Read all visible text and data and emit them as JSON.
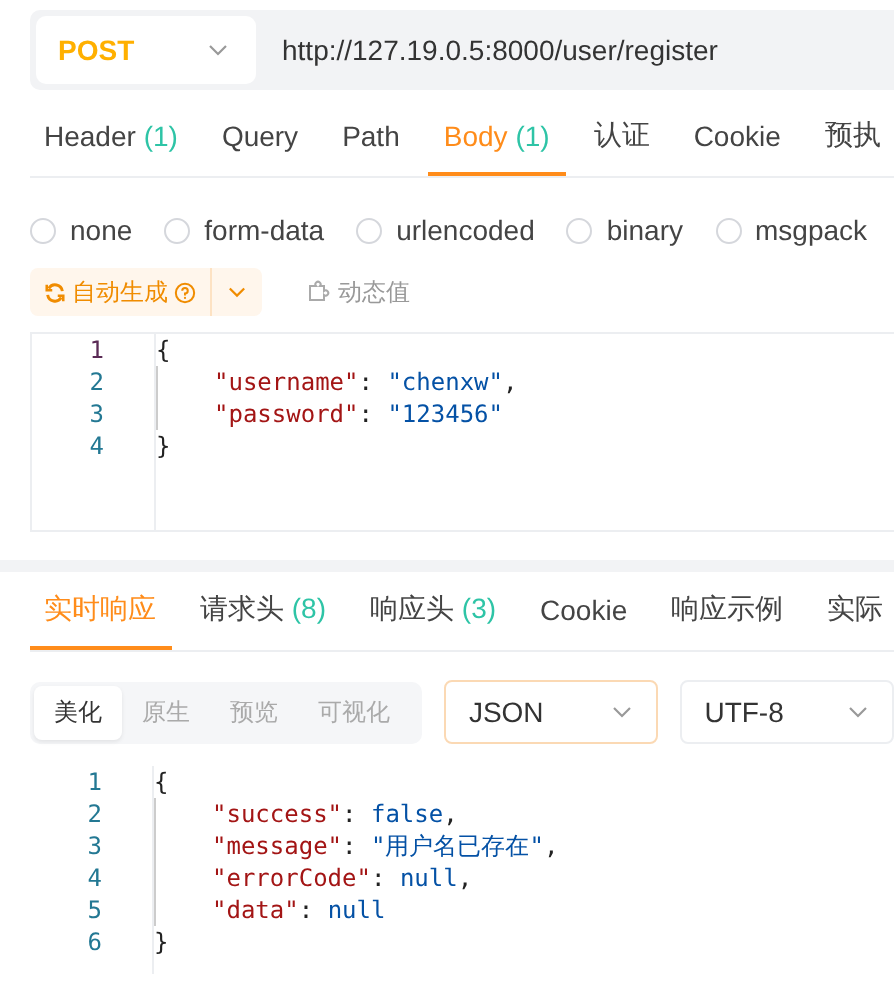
{
  "request": {
    "method": "POST",
    "url": "http://127.19.0.5:8000/user/register"
  },
  "request_tabs": [
    {
      "label": "Header",
      "count": "(1)",
      "selected": false
    },
    {
      "label": "Query",
      "selected": false
    },
    {
      "label": "Path",
      "selected": false
    },
    {
      "label": "Body",
      "count": "(1)",
      "selected": true
    },
    {
      "label": "认证",
      "selected": false
    },
    {
      "label": "Cookie",
      "selected": false
    },
    {
      "label": "预执",
      "selected": false
    }
  ],
  "body_types": [
    {
      "label": "none",
      "selected": false
    },
    {
      "label": "form-data",
      "selected": false
    },
    {
      "label": "urlencoded",
      "selected": false
    },
    {
      "label": "binary",
      "selected": false
    },
    {
      "label": "msgpack",
      "selected": false
    }
  ],
  "body_toolbar": {
    "auto_generate": "自动生成",
    "dynamic_value": "动态值"
  },
  "request_body": {
    "lines": [
      {
        "number": "1",
        "indented": false,
        "active": true,
        "tokens": [
          {
            "kind": "punct",
            "text": "{"
          }
        ]
      },
      {
        "number": "2",
        "indented": true,
        "active": false,
        "tokens": [
          {
            "kind": "key",
            "text": "\"username\""
          },
          {
            "kind": "punct",
            "text": ": "
          },
          {
            "kind": "string",
            "text": "\"chenxw\""
          },
          {
            "kind": "punct",
            "text": ","
          }
        ]
      },
      {
        "number": "3",
        "indented": true,
        "active": false,
        "tokens": [
          {
            "kind": "key",
            "text": "\"password\""
          },
          {
            "kind": "punct",
            "text": ": "
          },
          {
            "kind": "string",
            "text": "\"123456\""
          }
        ]
      },
      {
        "number": "4",
        "indented": false,
        "active": false,
        "tokens": [
          {
            "kind": "punct",
            "text": "}"
          }
        ]
      }
    ]
  },
  "response_tabs": [
    {
      "label": "实时响应",
      "selected": true
    },
    {
      "label": "请求头",
      "count": "(8)",
      "selected": false
    },
    {
      "label": "响应头",
      "count": "(3)",
      "selected": false
    },
    {
      "label": "Cookie",
      "selected": false
    },
    {
      "label": "响应示例",
      "selected": false
    },
    {
      "label": "实际",
      "selected": false
    }
  ],
  "view_modes": [
    {
      "label": "美化",
      "selected": true
    },
    {
      "label": "原生",
      "selected": false
    },
    {
      "label": "预览",
      "selected": false
    },
    {
      "label": "可视化",
      "selected": false
    }
  ],
  "format_select": {
    "value": "JSON"
  },
  "encoding_select": {
    "value": "UTF-8"
  },
  "response_body": {
    "lines": [
      {
        "number": "1",
        "indented": false,
        "active": false,
        "tokens": [
          {
            "kind": "punct",
            "text": "{"
          }
        ]
      },
      {
        "number": "2",
        "indented": true,
        "active": false,
        "tokens": [
          {
            "kind": "key",
            "text": "\"success\""
          },
          {
            "kind": "punct",
            "text": ": "
          },
          {
            "kind": "literal",
            "text": "false"
          },
          {
            "kind": "punct",
            "text": ","
          }
        ]
      },
      {
        "number": "3",
        "indented": true,
        "active": false,
        "tokens": [
          {
            "kind": "key",
            "text": "\"message\""
          },
          {
            "kind": "punct",
            "text": ": "
          },
          {
            "kind": "string",
            "text": "\"用户名已存在\""
          },
          {
            "kind": "punct",
            "text": ","
          }
        ]
      },
      {
        "number": "4",
        "indented": true,
        "active": false,
        "tokens": [
          {
            "kind": "key",
            "text": "\"errorCode\""
          },
          {
            "kind": "punct",
            "text": ": "
          },
          {
            "kind": "literal",
            "text": "null"
          },
          {
            "kind": "punct",
            "text": ","
          }
        ]
      },
      {
        "number": "5",
        "indented": true,
        "active": false,
        "tokens": [
          {
            "kind": "key",
            "text": "\"data\""
          },
          {
            "kind": "punct",
            "text": ": "
          },
          {
            "kind": "literal",
            "text": "null"
          }
        ]
      },
      {
        "number": "6",
        "indented": false,
        "active": false,
        "tokens": [
          {
            "kind": "punct",
            "text": "}"
          }
        ]
      }
    ]
  }
}
